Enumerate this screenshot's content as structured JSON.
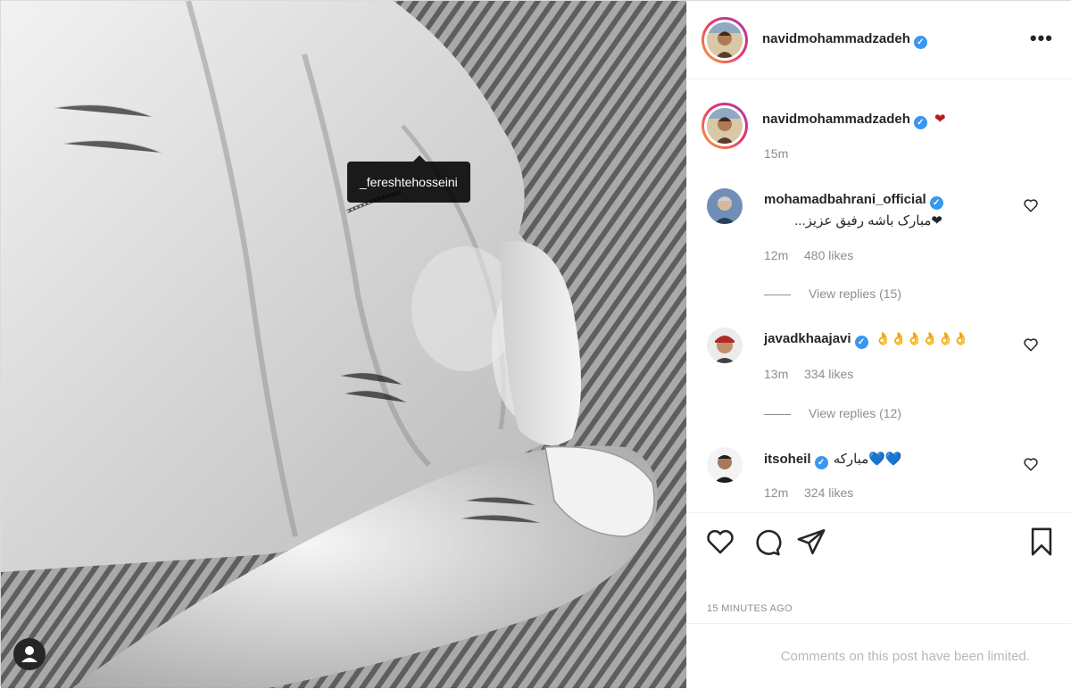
{
  "post": {
    "photo_tag": "_fereshtehosseini",
    "tag_icon": "user-silhouette-icon"
  },
  "header": {
    "username": "navidmohammadzadeh",
    "more_icon": "•••"
  },
  "caption": {
    "username": "navidmohammadzadeh",
    "text": "❤",
    "time": "15m"
  },
  "comments": [
    {
      "username": "mohamadbahrani_official",
      "text": "❤مبارک باشه رفیق عزیز...",
      "time": "12m",
      "likes": "480 likes",
      "replies": "View replies (15)"
    },
    {
      "username": "javadkhaajavi",
      "text": "👌👌👌👌👌👌",
      "time": "13m",
      "likes": "334 likes",
      "replies": "View replies (12)"
    },
    {
      "username": "itsoheil",
      "text": "مبارکه💙💙",
      "time": "12m",
      "likes": "324 likes"
    }
  ],
  "actions": {
    "like_icon": "heart-outline-icon",
    "comment_icon": "comment-bubble-icon",
    "share_icon": "paper-plane-icon",
    "save_icon": "bookmark-icon"
  },
  "timestamp": "15 MINUTES AGO",
  "limited_notice": "Comments on this post have been limited.",
  "colors": {
    "verified": "#3897f0",
    "heart_red": "#b71c1c",
    "teal_heart": "#1fb6c1",
    "muted": "#8e8e8e"
  }
}
